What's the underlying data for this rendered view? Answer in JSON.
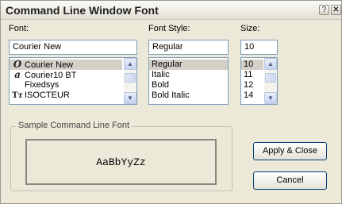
{
  "window": {
    "title": "Command Line Window Font"
  },
  "font": {
    "label": "Font:",
    "value": "Courier New",
    "items": [
      {
        "label": "Courier New",
        "icon": "opentype-font-icon",
        "glyph": "O",
        "selected": true
      },
      {
        "label": "Courier10 BT",
        "icon": "type1-font-icon",
        "glyph": "a",
        "selected": false
      },
      {
        "label": "Fixedsys",
        "icon": "",
        "glyph": "",
        "selected": false
      },
      {
        "label": "ISOCTEUR",
        "icon": "truetype-font-icon",
        "glyph": "Tт",
        "selected": false
      }
    ]
  },
  "style": {
    "label": "Font Style:",
    "value": "Regular",
    "items": [
      "Regular",
      "Italic",
      "Bold",
      "Bold Italic"
    ],
    "selected_index": 0
  },
  "size": {
    "label": "Size:",
    "value": "10",
    "items": [
      "10",
      "11",
      "12",
      "14"
    ],
    "selected_index": 0
  },
  "sample": {
    "group_label": "Sample Command Line Font",
    "text": "AaBbYyZz"
  },
  "buttons": {
    "apply_close": "Apply & Close",
    "cancel": "Cancel"
  },
  "icons": {
    "help": "help-icon",
    "close": "close-icon",
    "scroll_up": "chevron-up-icon",
    "scroll_down": "chevron-down-icon"
  }
}
